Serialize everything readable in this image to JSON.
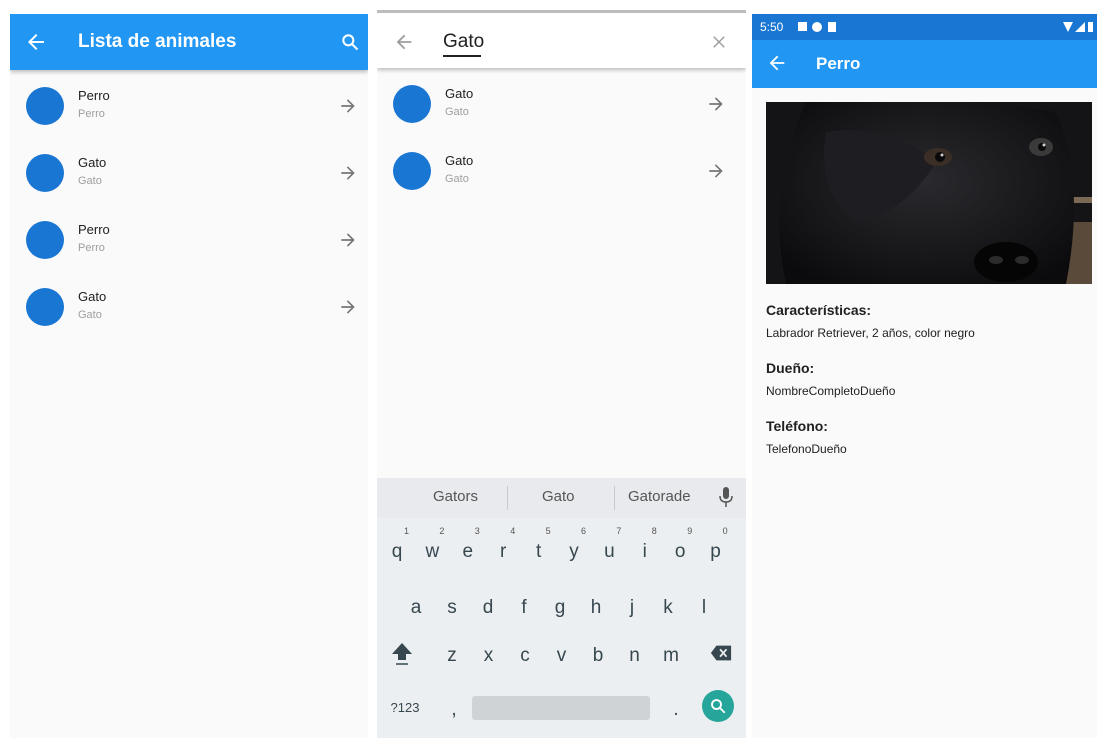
{
  "list_screen": {
    "title": "Lista de animales",
    "back_icon": "arrow-left-icon",
    "search_icon": "search-icon",
    "items": [
      {
        "title": "Perro",
        "subtitle": "Perro"
      },
      {
        "title": "Gato",
        "subtitle": "Gato"
      },
      {
        "title": "Perro",
        "subtitle": "Perro"
      },
      {
        "title": "Gato",
        "subtitle": "Gato"
      }
    ]
  },
  "search_screen": {
    "query": "Gato",
    "results": [
      {
        "title": "Gato",
        "subtitle": "Gato"
      },
      {
        "title": "Gato",
        "subtitle": "Gato"
      }
    ],
    "keyboard": {
      "suggestions": [
        "Gators",
        "Gato",
        "Gatorade"
      ],
      "row1": [
        "q",
        "w",
        "e",
        "r",
        "t",
        "y",
        "u",
        "i",
        "o",
        "p"
      ],
      "row1_hints": [
        "1",
        "2",
        "3",
        "4",
        "5",
        "6",
        "7",
        "8",
        "9",
        "0"
      ],
      "row2": [
        "a",
        "s",
        "d",
        "f",
        "g",
        "h",
        "j",
        "k",
        "l"
      ],
      "row3": [
        "z",
        "x",
        "c",
        "v",
        "b",
        "n",
        "m"
      ],
      "symbols_key": "?123",
      "comma_key": ",",
      "period_key": "."
    }
  },
  "detail_screen": {
    "status_time": "5:50",
    "title": "Perro",
    "characteristics_label": "Características:",
    "characteristics_value": "Labrador Retriever, 2 años, color negro",
    "owner_label": "Dueño:",
    "owner_value": "NombreCompletoDueño",
    "phone_label": "Teléfono:",
    "phone_value": "TelefonoDueño"
  },
  "colors": {
    "primary": "#2196f3",
    "status_bar": "#1976d2",
    "avatar": "#1976d2",
    "fab": "#26a69a"
  }
}
